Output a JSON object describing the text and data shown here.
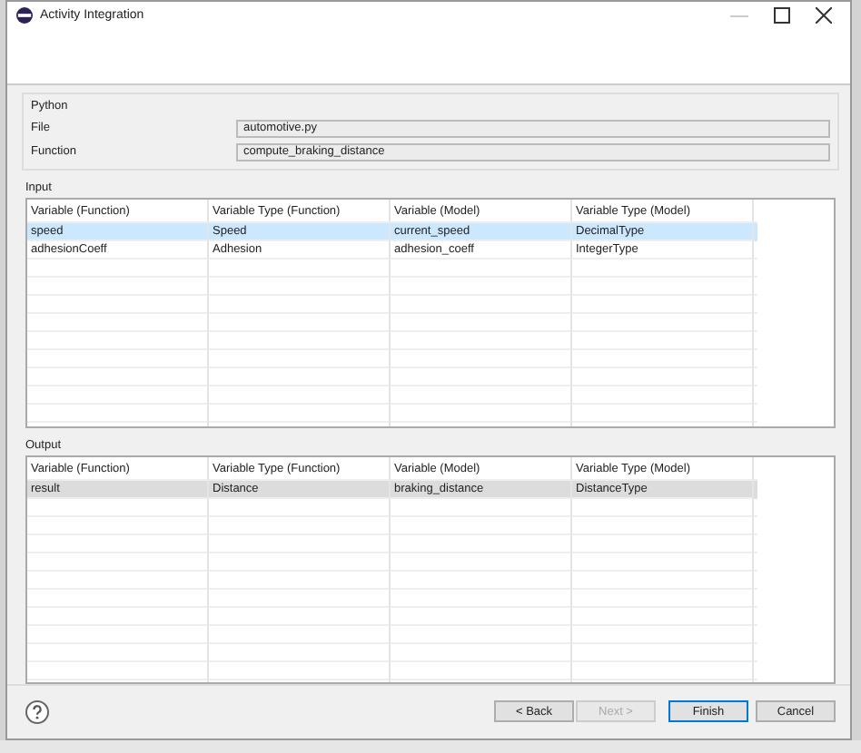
{
  "window": {
    "title": "Activity Integration"
  },
  "python": {
    "label": "Python",
    "fields": [
      {
        "label": "File",
        "value": "automotive.py"
      },
      {
        "label": "Function",
        "value": "compute_braking_distance"
      }
    ]
  },
  "input": {
    "label": "Input",
    "focused": true,
    "columns": [
      "Variable (Function)",
      "Variable Type (Function)",
      "Variable (Model)",
      "Variable Type (Model)"
    ],
    "rows": [
      {
        "cells": [
          "speed",
          "Speed",
          "current_speed",
          "DecimalType"
        ],
        "selected": true
      },
      {
        "cells": [
          "adhesionCoeff",
          "Adhesion",
          "adhesion_coeff",
          "IntegerType"
        ],
        "selected": false
      }
    ]
  },
  "output": {
    "label": "Output",
    "focused": false,
    "columns": [
      "Variable (Function)",
      "Variable Type (Function)",
      "Variable (Model)",
      "Variable Type (Model)"
    ],
    "rows": [
      {
        "cells": [
          "result",
          "Distance",
          "braking_distance",
          "DistanceType"
        ],
        "selected": true
      }
    ]
  },
  "buttons": [
    {
      "label": "< Back",
      "disabled": false,
      "default": false
    },
    {
      "label": "Next >",
      "disabled": true,
      "default": false
    },
    {
      "label": "Finish",
      "disabled": false,
      "default": true
    },
    {
      "label": "Cancel",
      "disabled": false,
      "default": false
    }
  ]
}
